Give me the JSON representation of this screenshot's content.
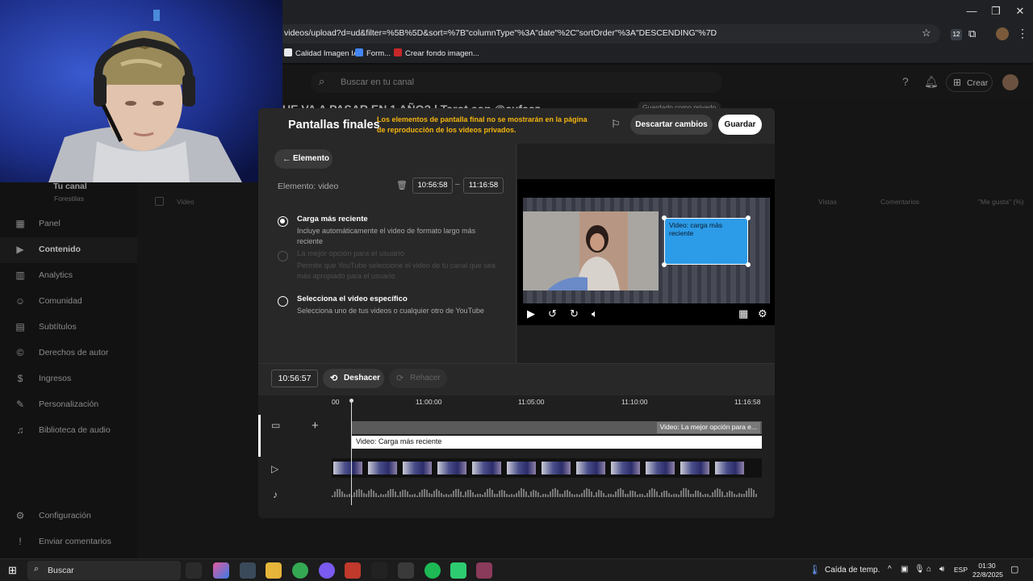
{
  "browser": {
    "url": "videos/upload?d=ud&filter=%5B%5D&sort=%7B\"columnType\"%3A\"date\"%2C\"sortOrder\"%3A\"DESCENDING\"%7D",
    "extensions_badge": "12",
    "bookmarks": [
      {
        "label": "Calidad Imagen IA",
        "color": "#e8eaed"
      },
      {
        "label": "Form...",
        "color": "#4285f4"
      },
      {
        "label": "Crear fondo imagen...",
        "color": "#c62828"
      }
    ]
  },
  "yt_header": {
    "search_placeholder": "Buscar en tu canal",
    "create_label": "Crear"
  },
  "sidebar": {
    "channel_name": "Tu canal",
    "channel_handle": "Forestilas",
    "items": [
      {
        "label": "Panel",
        "icon": "dashboard-icon",
        "glyph": "▦"
      },
      {
        "label": "Contenido",
        "icon": "content-icon",
        "glyph": "▶"
      },
      {
        "label": "Analytics",
        "icon": "analytics-icon",
        "glyph": "▥"
      },
      {
        "label": "Comunidad",
        "icon": "community-icon",
        "glyph": "☺"
      },
      {
        "label": "Subtítulos",
        "icon": "subtitles-icon",
        "glyph": "▤"
      },
      {
        "label": "Derechos de autor",
        "icon": "copyright-icon",
        "glyph": "©"
      },
      {
        "label": "Ingresos",
        "icon": "earn-icon",
        "glyph": "$"
      },
      {
        "label": "Personalización",
        "icon": "customization-icon",
        "glyph": "✎"
      },
      {
        "label": "Biblioteca de audio",
        "icon": "audio-library-icon",
        "glyph": "♫"
      }
    ],
    "bottom_items": [
      {
        "label": "Configuración",
        "icon": "settings-icon",
        "glyph": "⚙"
      },
      {
        "label": "Enviar comentarios",
        "icon": "feedback-icon",
        "glyph": "!"
      }
    ]
  },
  "background_page": {
    "video_title": "UE VA A PASAR EN 1 AÑO? | Tarot con @cufasz",
    "saved_status": "Guardado como privado",
    "columns": [
      "Video",
      "Vistas",
      "Comentarios",
      "\"Me gusta\" (%)"
    ]
  },
  "modal": {
    "title": "Pantallas finales",
    "warning": "Los elementos de pantalla final no se mostrarán en la página de reproducción de los videos privados.",
    "discard_label": "Descartar cambios",
    "save_label": "Guardar",
    "element_chip": "Elemento",
    "element_type_label": "Elemento: video",
    "start_time": "10:56:58",
    "end_time": "11:16:58",
    "options": [
      {
        "title": "Carga más reciente",
        "desc": "Incluye automáticamente el video de formato largo más reciente",
        "selected": true,
        "disabled": false
      },
      {
        "title": "La mejor opción para el usuario",
        "desc": "Permite que YouTube seleccione el video de tu canal que sea más apropiado para el usuario",
        "selected": false,
        "disabled": true
      },
      {
        "title": "Selecciona el video específico",
        "desc": "Selecciona uno de tus videos o cualquier otro de YouTube",
        "selected": false,
        "disabled": false
      }
    ],
    "preview_element_label": "Video: carga más reciente"
  },
  "timeline": {
    "current_time": "10:56:57",
    "undo_label": "Deshacer",
    "redo_label": "Rehacer",
    "ruler": [
      "00",
      "11:00:00",
      "11:05:00",
      "11:10:00",
      "11:16:58"
    ],
    "endscreen_track_label": "Video: La mejor opción para e...",
    "video_element_label": "Video: Carga más reciente"
  },
  "taskbar": {
    "search_placeholder": "Buscar",
    "weather": "Caída de temp.",
    "language": "ESP",
    "time": "01:30",
    "date": "22/8/2025"
  }
}
